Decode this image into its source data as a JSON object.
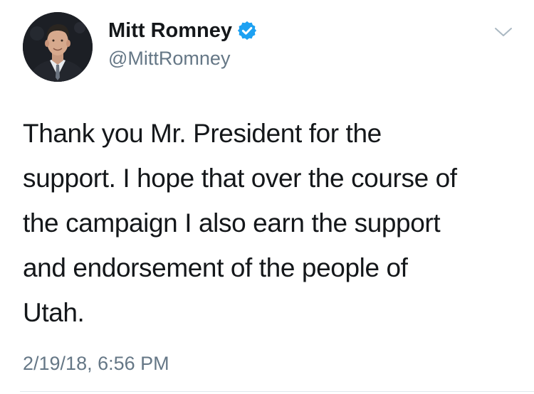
{
  "tweet": {
    "author": {
      "display_name": "Mitt Romney",
      "handle": "@MittRomney",
      "verified": true,
      "avatar_icon": "profile-photo",
      "verified_color": "#1da1f2"
    },
    "menu_icon": "chevron-down-icon",
    "text": "Thank you Mr. President for the\nsupport. I hope that over the course of\nthe campaign I also earn the support\nand endorsement of the people of\nUtah.",
    "timestamp": "2/19/18, 6:56 PM"
  },
  "colors": {
    "text_primary": "#14171a",
    "text_secondary": "#657786",
    "verified_blue": "#1da1f2",
    "divider": "#e1e8ed"
  }
}
